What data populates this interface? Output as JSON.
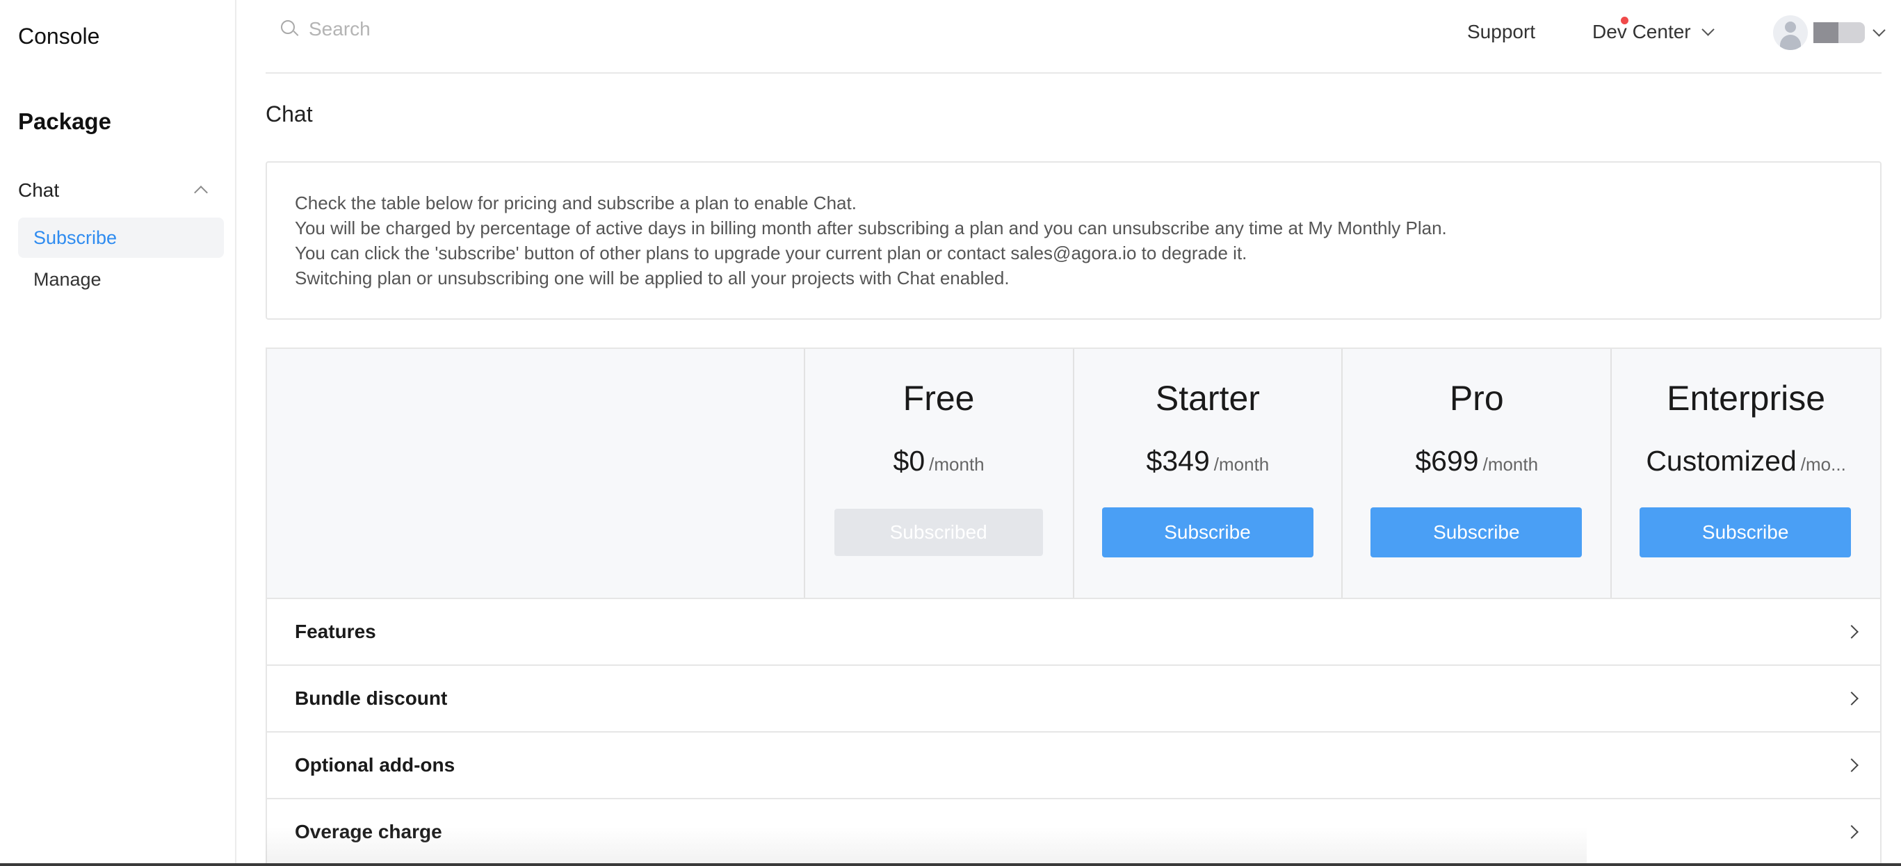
{
  "sidebar": {
    "brand": "Console",
    "section_title": "Package",
    "group_label": "Chat",
    "items": [
      {
        "label": "Subscribe"
      },
      {
        "label": "Manage"
      }
    ]
  },
  "topbar": {
    "search_placeholder": "Search",
    "support_label": "Support",
    "devcenter_label": "Dev Center"
  },
  "page": {
    "title": "Chat",
    "notice_lines": [
      "Check the table below for pricing and subscribe a plan to enable Chat.",
      "You will be charged by percentage of active days in billing month after subscribing a plan and you can unsubscribe any time at My Monthly Plan.",
      "You can click the 'subscribe' button of other plans to upgrade your current plan or contact sales@agora.io to degrade it.",
      "Switching plan or unsubscribing one will be applied to all your projects with Chat enabled."
    ]
  },
  "plans": [
    {
      "name": "Free",
      "price": "$0",
      "period": "/month",
      "button": "Subscribed"
    },
    {
      "name": "Starter",
      "price": "$349",
      "period": "/month",
      "button": "Subscribe"
    },
    {
      "name": "Pro",
      "price": "$699",
      "period": "/month",
      "button": "Subscribe"
    },
    {
      "name": "Enterprise",
      "price": "Customized",
      "period": "/mo...",
      "button": "Subscribe"
    }
  ],
  "sections": [
    {
      "label": "Features"
    },
    {
      "label": "Bundle discount"
    },
    {
      "label": "Optional add-ons"
    },
    {
      "label": "Overage charge"
    }
  ],
  "colors": {
    "accent": "#4a9ff5",
    "active_link": "#2f8cf0",
    "notification_dot": "#f04a4a"
  }
}
